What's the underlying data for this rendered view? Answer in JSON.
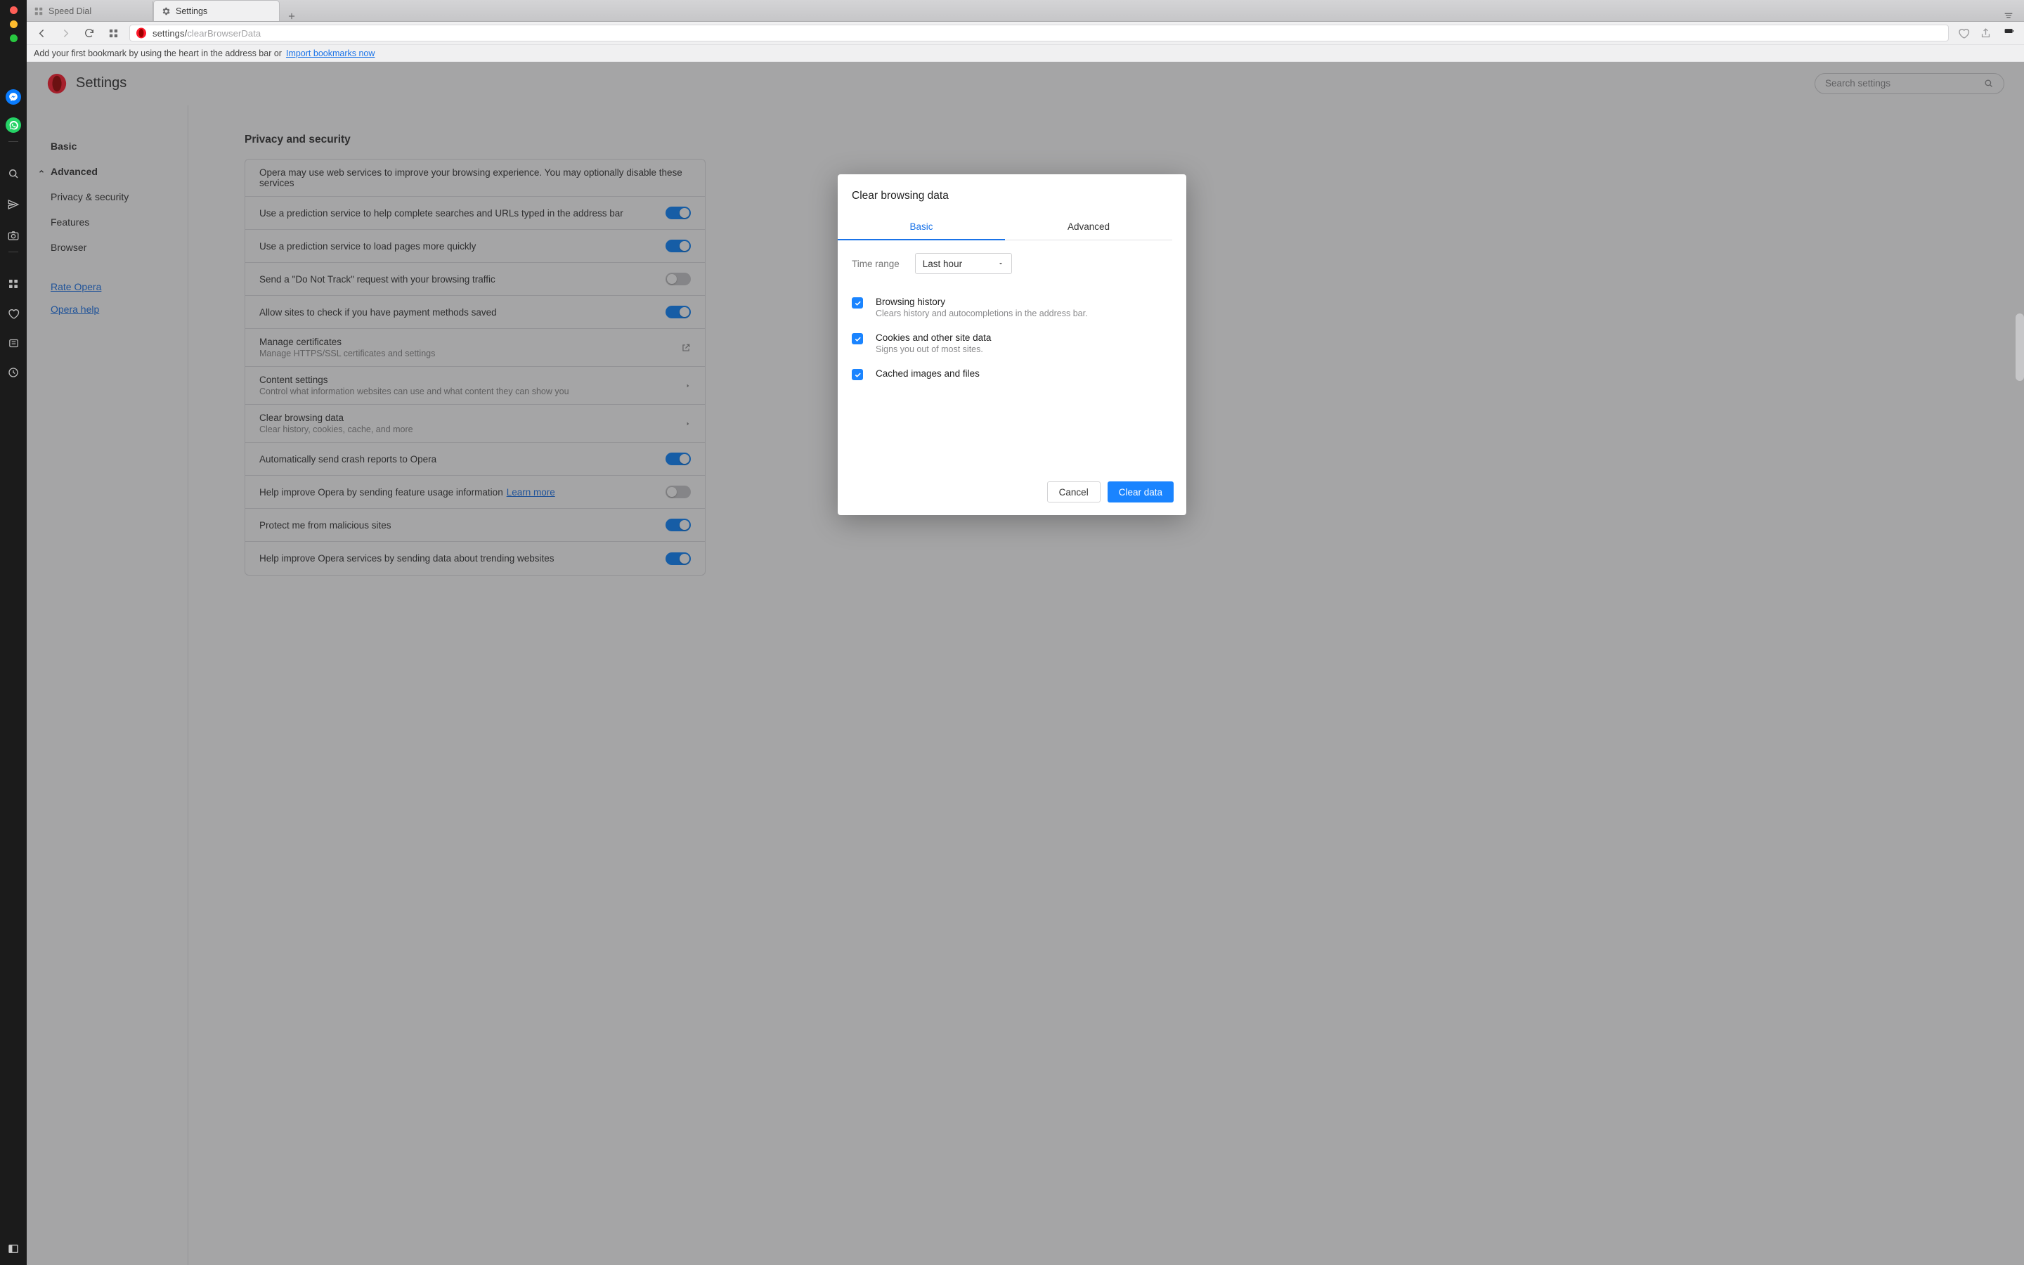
{
  "macbar": {
    "messenger": "messenger",
    "whatsapp": "whatsapp"
  },
  "tabs": {
    "speed_dial": "Speed Dial",
    "settings": "Settings"
  },
  "addr": {
    "scheme": "settings/",
    "path": "clearBrowserData"
  },
  "bmbar": {
    "text": "Add your first bookmark by using the heart in the address bar or",
    "link": "Import bookmarks now"
  },
  "header": {
    "title": "Settings",
    "search_placeholder": "Search settings"
  },
  "nav": {
    "basic": "Basic",
    "advanced": "Advanced",
    "privacy": "Privacy & security",
    "features": "Features",
    "browser": "Browser",
    "rate": "Rate Opera",
    "help": "Opera help"
  },
  "section": {
    "title": "Privacy and security",
    "rows": [
      {
        "title": "Opera may use web services to improve your browsing experience. You may optionally disable these services",
        "sub": "",
        "ctrl": "none"
      },
      {
        "title": "Use a prediction service to help complete searches and URLs typed in the address bar",
        "ctrl": "on"
      },
      {
        "title": "Use a prediction service to load pages more quickly",
        "ctrl": "on"
      },
      {
        "title": "Send a \"Do Not Track\" request with your browsing traffic",
        "ctrl": "off"
      },
      {
        "title": "Allow sites to check if you have payment methods saved",
        "ctrl": "on"
      },
      {
        "title": "Manage certificates",
        "sub": "Manage HTTPS/SSL certificates and settings",
        "ctrl": "ext"
      },
      {
        "title": "Content settings",
        "sub": "Control what information websites can use and what content they can show you",
        "ctrl": "chev"
      },
      {
        "title": "Clear browsing data",
        "sub": "Clear history, cookies, cache, and more",
        "ctrl": "chev"
      },
      {
        "title": "Automatically send crash reports to Opera",
        "ctrl": "on"
      },
      {
        "title": "Help improve Opera by sending feature usage information",
        "lm": "Learn more",
        "ctrl": "off"
      },
      {
        "title": "Protect me from malicious sites",
        "ctrl": "on"
      },
      {
        "title": "Help improve Opera services by sending data about trending websites",
        "ctrl": "on"
      }
    ]
  },
  "modal": {
    "title": "Clear browsing data",
    "tab_basic": "Basic",
    "tab_adv": "Advanced",
    "time_range_label": "Time range",
    "time_range_value": "Last hour",
    "items": [
      {
        "title": "Browsing history",
        "sub": "Clears history and autocompletions in the address bar."
      },
      {
        "title": "Cookies and other site data",
        "sub": "Signs you out of most sites."
      },
      {
        "title": "Cached images and files",
        "sub": ""
      }
    ],
    "cancel": "Cancel",
    "clear": "Clear data"
  }
}
